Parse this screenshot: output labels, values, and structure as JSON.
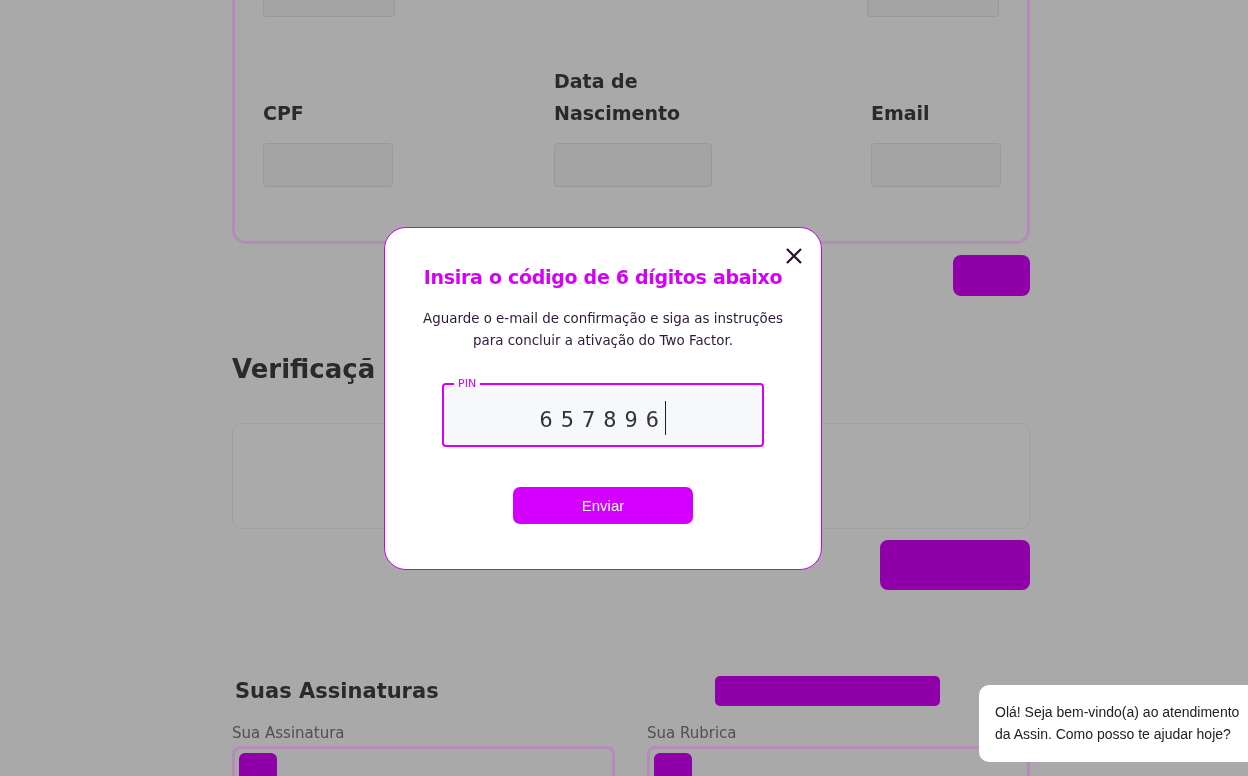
{
  "profile_form": {
    "fields": [
      {
        "label": "CPF"
      },
      {
        "label": "Data de Nascimento"
      },
      {
        "label": "Email"
      }
    ]
  },
  "verification": {
    "heading": "Verificaçã"
  },
  "signatures": {
    "heading": "Suas Assinaturas",
    "panels": [
      {
        "label": "Sua Assinatura"
      },
      {
        "label": "Sua Rubrica"
      }
    ]
  },
  "modal": {
    "title": "Insira o código de 6 dígitos abaixo",
    "message": "Aguarde o e-mail de confirmação e siga as instruções para concluir a ativação do Two Factor.",
    "pin": {
      "label": "PIN",
      "value": "657896",
      "focused": true
    },
    "submit": "Enviar"
  },
  "chat": {
    "message": "Olá! Seja bem-vindo(a) ao atendimento da Assin. Como posso te ajudar hoje?"
  }
}
